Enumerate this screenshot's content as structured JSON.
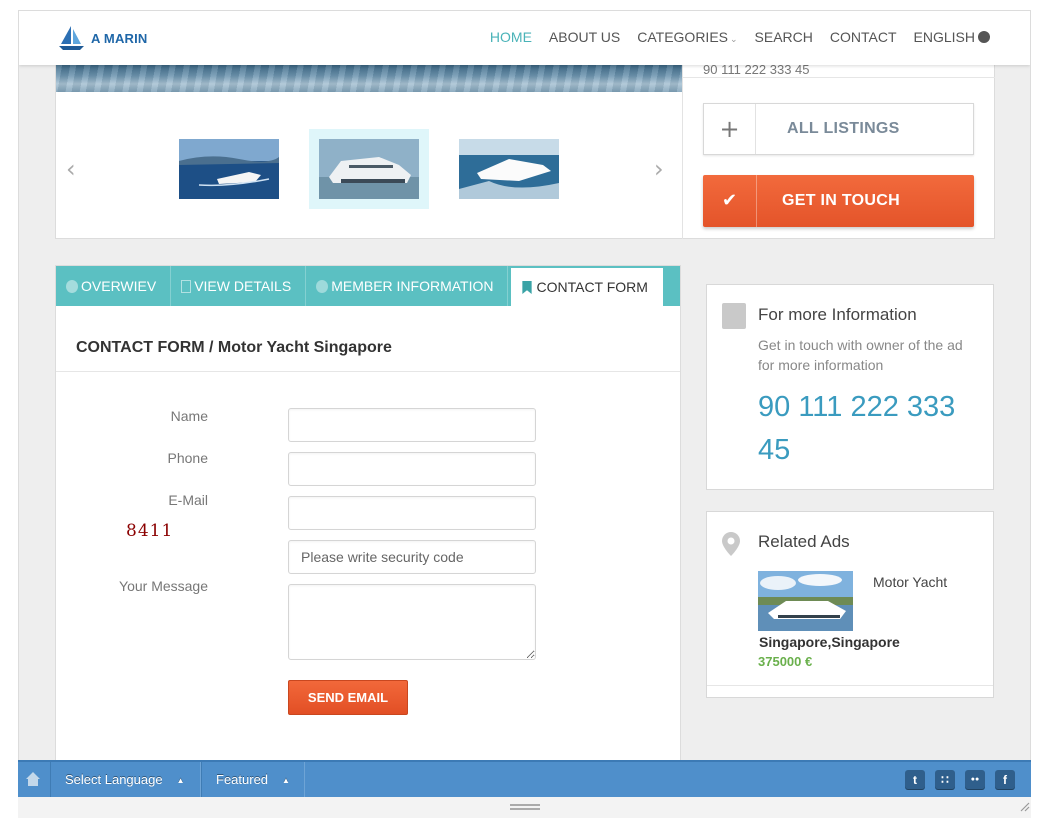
{
  "brand": {
    "logo_text": "A MARIN"
  },
  "nav": {
    "items": [
      {
        "label": "HOME",
        "active": true
      },
      {
        "label": "ABOUT US",
        "active": false
      },
      {
        "label": "CATEGORIES",
        "active": false,
        "icon": "chevron-down-icon"
      },
      {
        "label": "SEARCH",
        "active": false
      },
      {
        "label": "CONTACT",
        "active": false
      },
      {
        "label": "ENGLISH",
        "active": false,
        "icon": "globe-icon"
      }
    ]
  },
  "gallery": {
    "selected_index": 1,
    "thumbs": [
      "yacht-thumb-1",
      "yacht-thumb-2",
      "yacht-thumb-3"
    ],
    "prev_icon": "chevron-left-icon",
    "next_icon": "chevron-right-icon"
  },
  "sidebar_top": {
    "phone": "90 111 222 333 45",
    "all_listings_label": "ALL LISTINGS",
    "get_in_touch_label": "GET IN TOUCH"
  },
  "tabs": [
    {
      "label": "OVERWIEV",
      "icon": "info-icon",
      "active": false
    },
    {
      "label": "VIEW DETAILS",
      "icon": "document-icon",
      "active": false
    },
    {
      "label": "MEMBER INFORMATION",
      "icon": "user-icon",
      "active": false
    },
    {
      "label": "CONTACT FORM",
      "icon": "bookmark-icon",
      "active": true
    }
  ],
  "contact_form": {
    "title": "CONTACT FORM / Motor Yacht Singapore",
    "name_label": "Name",
    "phone_label": "Phone",
    "email_label": "E-Mail",
    "captcha_code": "8411",
    "security_placeholder": "Please write security code",
    "message_label": "Your Message",
    "name_value": "",
    "phone_value": "",
    "email_value": "",
    "message_value": "",
    "send_label": "SEND EMAIL"
  },
  "info_box": {
    "title": "For more Information",
    "description": "Get in touch with owner of the ad for more information",
    "phone": "90 111 222 333 45"
  },
  "related": {
    "title": "Related Ads",
    "item": {
      "name": "Motor Yacht",
      "location": "Singapore,Singapore",
      "price": "375000 €"
    }
  },
  "bottom_bar": {
    "language_label": "Select Language",
    "featured_label": "Featured",
    "social": [
      {
        "icon": "twitter-icon",
        "glyph": "t"
      },
      {
        "icon": "rss-icon",
        "glyph": "∷"
      },
      {
        "icon": "flickr-icon",
        "glyph": "●●"
      },
      {
        "icon": "facebook-icon",
        "glyph": "f"
      }
    ]
  },
  "colors": {
    "accent_teal": "#5bc0c2",
    "active_nav": "#4ab3b8",
    "cta_orange": "#e95a2e",
    "phone_blue": "#3a9bbf",
    "price_green": "#6ab04c",
    "bottom_bar_blue": "#4f8fcb"
  }
}
